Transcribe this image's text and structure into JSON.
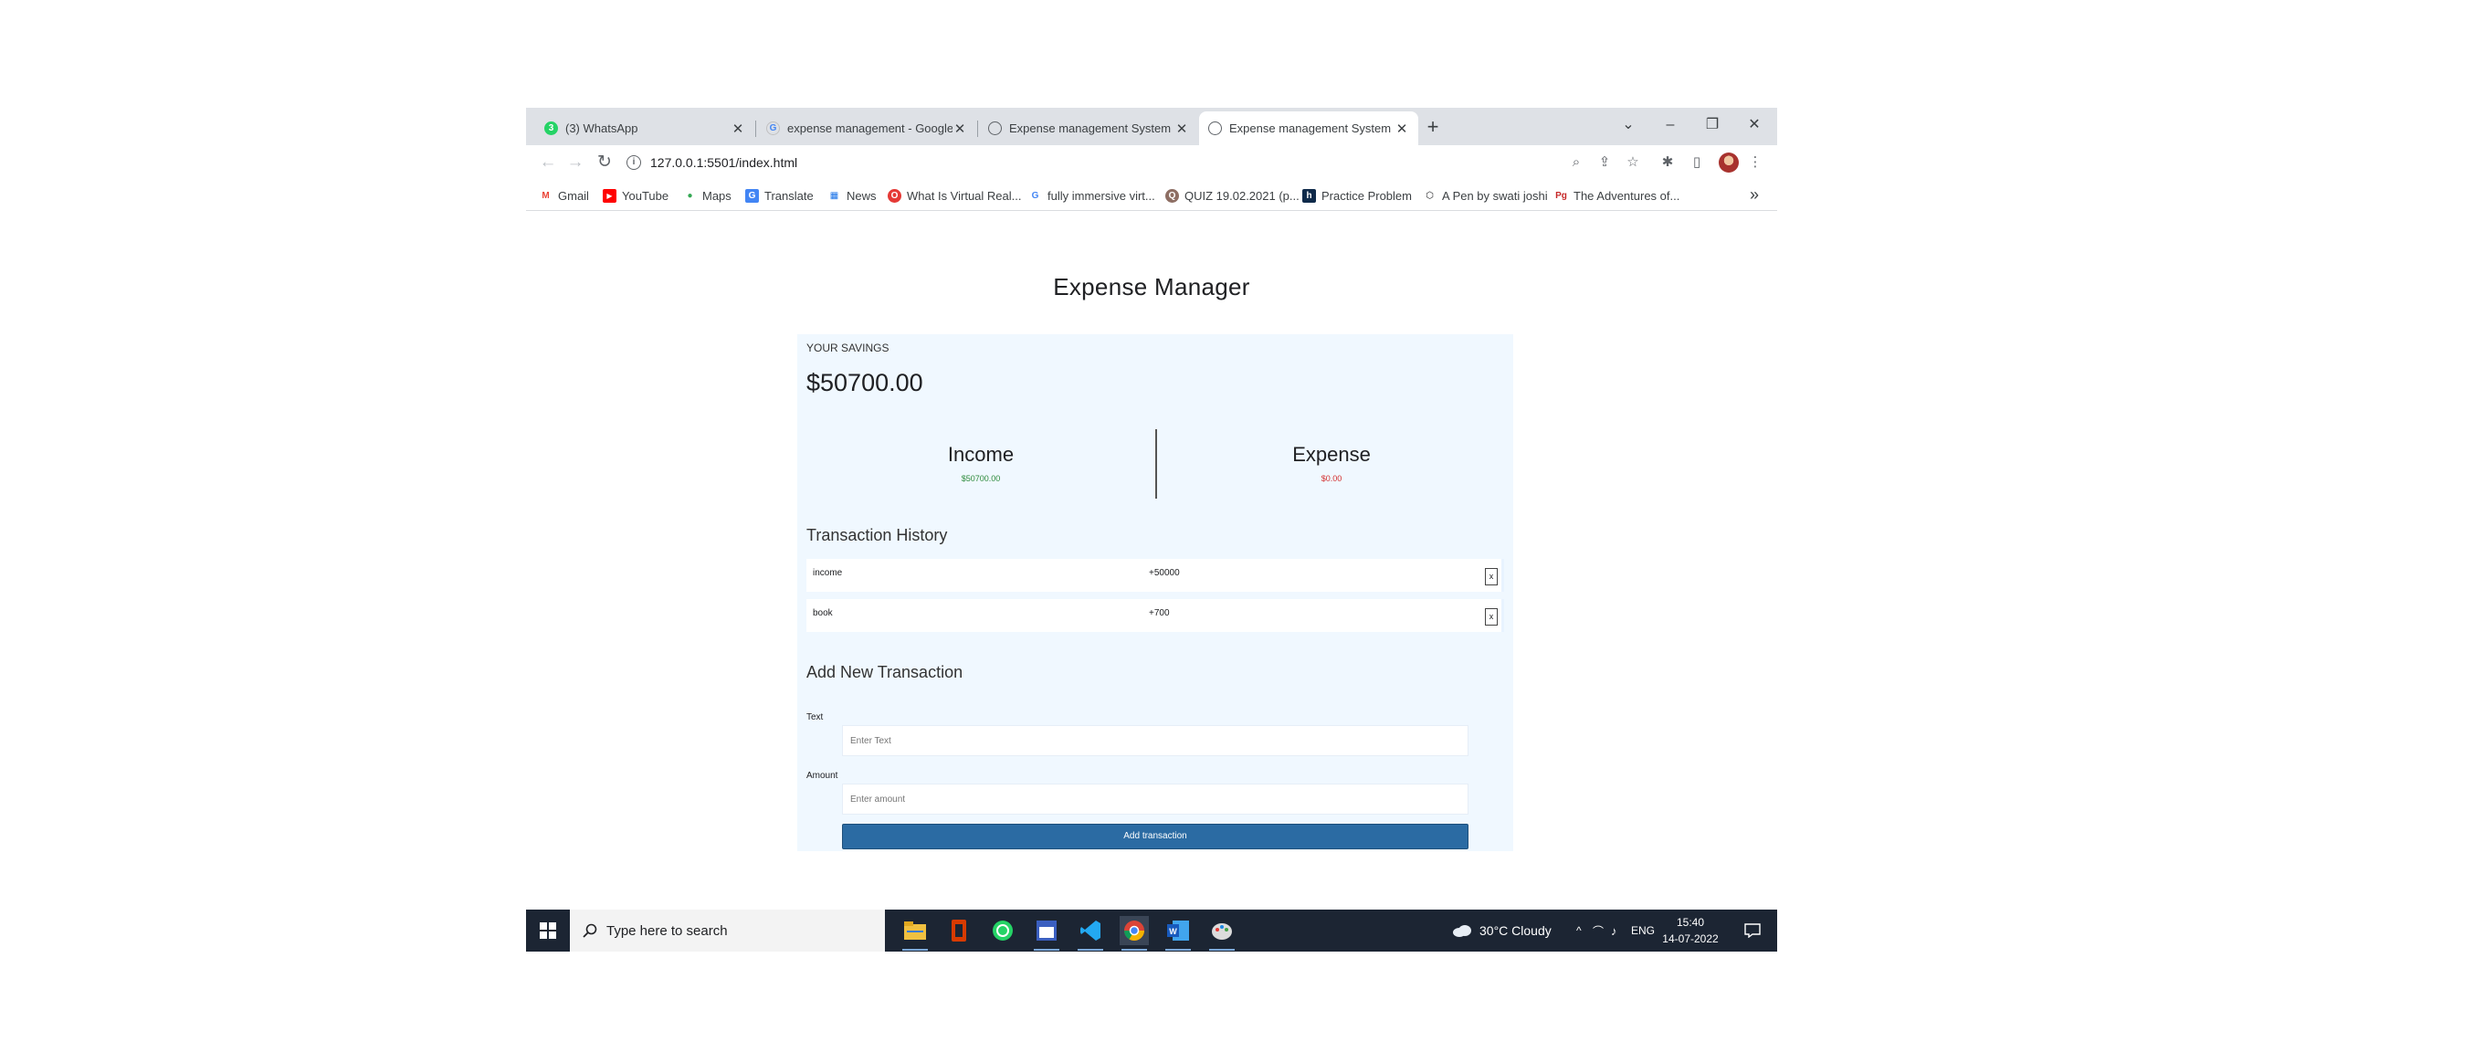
{
  "browser": {
    "tabs": [
      {
        "title": "(3) WhatsApp",
        "favicon": "whatsapp-icon"
      },
      {
        "title": "expense management - Google Search",
        "favicon": "google-icon"
      },
      {
        "title": "Expense management System",
        "favicon": "globe-icon"
      },
      {
        "title": "Expense management System",
        "favicon": "globe-icon",
        "active": true
      }
    ],
    "url": "127.0.0.1:5501/index.html",
    "bookmarks": [
      "Gmail",
      "YouTube",
      "Maps",
      "Translate",
      "News",
      "What Is Virtual Real...",
      "fully immersive virt...",
      "QUIZ 19.02.2021 (p...",
      "Practice Problem",
      "A Pen by swati joshi",
      "The Adventures of..."
    ]
  },
  "app": {
    "title": "Expense Manager",
    "savings_label": "YOUR SAVINGS",
    "savings_value": "$50700.00",
    "income_label": "Income",
    "income_value": "$50700.00",
    "expense_label": "Expense",
    "expense_value": "$0.00",
    "history_title": "Transaction History",
    "transactions": [
      {
        "text": "income",
        "amount": "+50000",
        "delete": "x"
      },
      {
        "text": "book",
        "amount": "+700",
        "delete": "x"
      }
    ],
    "add_title": "Add New Transaction",
    "text_label": "Text",
    "text_placeholder": "Enter Text",
    "amount_label": "Amount",
    "amount_placeholder": "Enter amount",
    "add_button": "Add transaction",
    "colors": {
      "income": "#2e8b3d",
      "expense": "#d32f2f",
      "button": "#2b6ba3",
      "card": "#f0f8ff"
    }
  },
  "taskbar": {
    "search_placeholder": "Type here to search",
    "weather": "30°C  Cloudy",
    "language": "ENG",
    "time": "15:40",
    "date": "14-07-2022"
  }
}
